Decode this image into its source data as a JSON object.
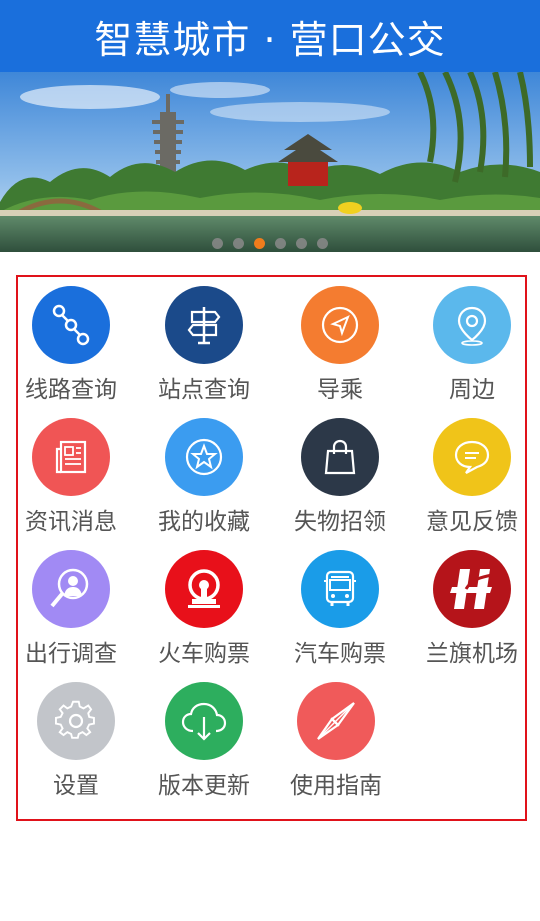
{
  "header": {
    "title": "智慧城市 · 营口公交"
  },
  "banner": {
    "slide_count": 6,
    "active_slide": 2
  },
  "colors": {
    "header_bg": "#1a6fdc",
    "grid_border": "#e0121a",
    "dot_active": "#f07c1c"
  },
  "menu": [
    {
      "label": "线路查询",
      "icon": "route-icon",
      "color": "#1a6fdc"
    },
    {
      "label": "站点查询",
      "icon": "signpost-icon",
      "color": "#1b4a8a"
    },
    {
      "label": "导乘",
      "icon": "compass-arrow-icon",
      "color": "#f47c30"
    },
    {
      "label": "周边",
      "icon": "location-pin-icon",
      "color": "#5bb8ec"
    },
    {
      "label": "资讯消息",
      "icon": "newspaper-icon",
      "color": "#f05555"
    },
    {
      "label": "我的收藏",
      "icon": "star-icon",
      "color": "#3b9cf0"
    },
    {
      "label": "失物招领",
      "icon": "shopping-bag-icon",
      "color": "#2c3848"
    },
    {
      "label": "意见反馈",
      "icon": "chat-bubble-icon",
      "color": "#f0c419"
    },
    {
      "label": "出行调查",
      "icon": "survey-person-icon",
      "color": "#a18af4"
    },
    {
      "label": "火车购票",
      "icon": "railway-logo-icon",
      "color": "#e8101a"
    },
    {
      "label": "汽车购票",
      "icon": "bus-icon",
      "color": "#1a9ce8"
    },
    {
      "label": "兰旗机场",
      "icon": "airport-logo-icon",
      "color": "#b5141a"
    },
    {
      "label": "设置",
      "icon": "gear-icon",
      "color": "#c2c5ca"
    },
    {
      "label": "版本更新",
      "icon": "cloud-download-icon",
      "color": "#2dae5e"
    },
    {
      "label": "使用指南",
      "icon": "compass-needle-icon",
      "color": "#f05a5a"
    }
  ]
}
